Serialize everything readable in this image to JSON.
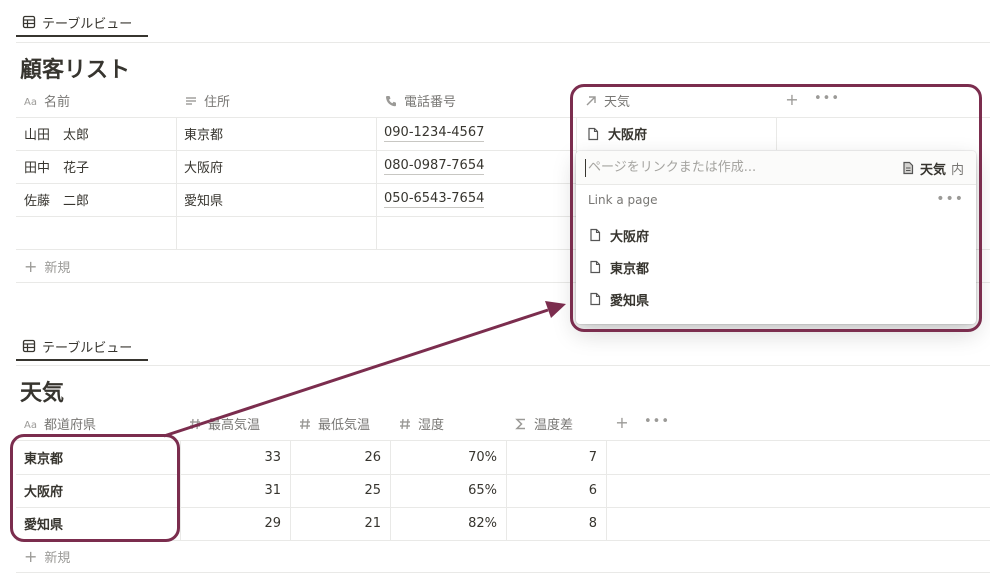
{
  "customers": {
    "view_tab_label": "テーブルビュー",
    "title": "顧客リスト",
    "columns": [
      {
        "label": "名前",
        "icon": "title-aa-icon"
      },
      {
        "label": "住所",
        "icon": "text-lines-icon"
      },
      {
        "label": "電話番号",
        "icon": "phone-icon"
      },
      {
        "label": "天気",
        "icon": "relation-arrow-icon"
      }
    ],
    "rows": [
      {
        "name": "山田　太郎",
        "address": "東京都",
        "phone": "090-1234-4567",
        "weather": "大阪府"
      },
      {
        "name": "田中　花子",
        "address": "大阪府",
        "phone": "080-0987-7654",
        "weather": ""
      },
      {
        "name": "佐藤　二郎",
        "address": "愛知県",
        "phone": "050-6543-7654",
        "weather": ""
      }
    ],
    "new_label": "新規"
  },
  "relation_popup": {
    "search_placeholder": "ページをリンクまたは作成...",
    "scope_db": "天気",
    "scope_suffix": "内",
    "section_label": "Link a page",
    "items": [
      "大阪府",
      "東京都",
      "愛知県"
    ]
  },
  "weather": {
    "view_tab_label": "テーブルビュー",
    "title": "天気",
    "columns": [
      {
        "label": "都道府県",
        "icon": "title-aa-icon"
      },
      {
        "label": "最高気温",
        "icon": "number-hash-icon"
      },
      {
        "label": "最低気温",
        "icon": "number-hash-icon"
      },
      {
        "label": "湿度",
        "icon": "number-hash-icon"
      },
      {
        "label": "温度差",
        "icon": "formula-sigma-icon"
      }
    ],
    "rows": [
      {
        "prefecture": "東京都",
        "high": "33",
        "low": "26",
        "humidity": "70%",
        "diff": "7"
      },
      {
        "prefecture": "大阪府",
        "high": "31",
        "low": "25",
        "humidity": "65%",
        "diff": "6"
      },
      {
        "prefecture": "愛知県",
        "high": "29",
        "low": "21",
        "humidity": "82%",
        "diff": "8"
      }
    ],
    "new_label": "新規"
  },
  "colors": {
    "highlight": "#7b2d4e",
    "text": "#37352f",
    "muted": "#787774",
    "border": "#e9e9e7"
  }
}
